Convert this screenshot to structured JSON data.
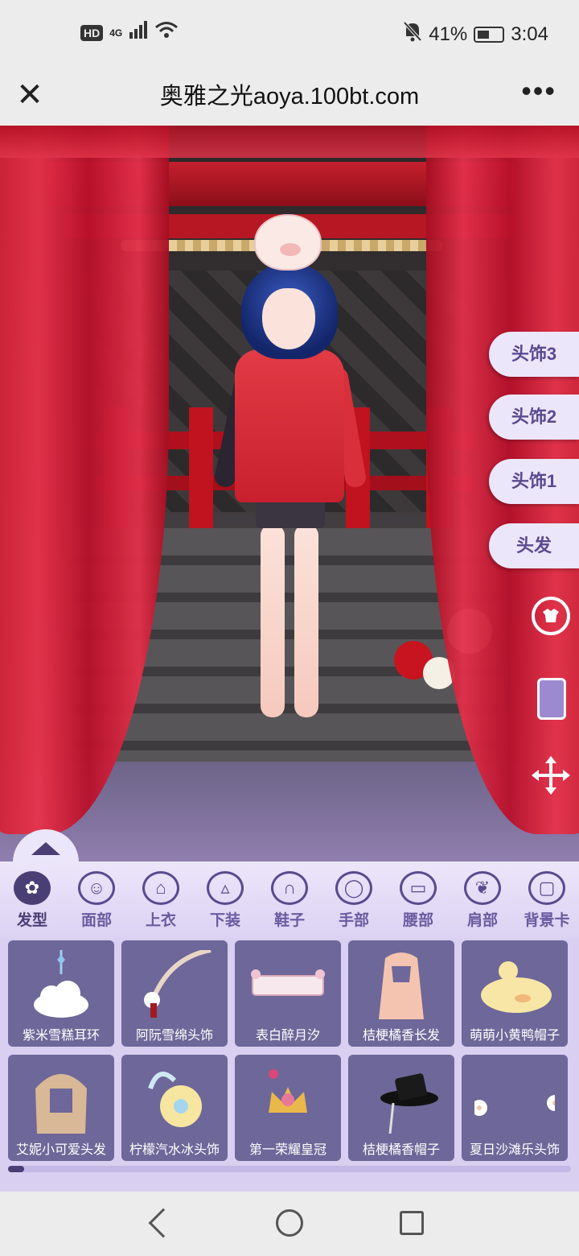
{
  "status_bar": {
    "network": "HD",
    "signal": "4G",
    "battery": "41%",
    "time": "3:04"
  },
  "browser": {
    "title": "奥雅之光aoya.100bt.com"
  },
  "side_slots": [
    "头饰3",
    "头饰2",
    "头饰1",
    "头发"
  ],
  "categories": [
    {
      "label": "发型",
      "icon": "hair-icon",
      "active": true
    },
    {
      "label": "面部",
      "icon": "face-icon"
    },
    {
      "label": "上衣",
      "icon": "top-icon"
    },
    {
      "label": "下装",
      "icon": "skirt-icon"
    },
    {
      "label": "鞋子",
      "icon": "shoes-icon"
    },
    {
      "label": "手部",
      "icon": "ring-icon"
    },
    {
      "label": "腰部",
      "icon": "belt-icon"
    },
    {
      "label": "肩部",
      "icon": "wings-icon"
    },
    {
      "label": "背景卡",
      "icon": "background-card-icon"
    }
  ],
  "items": [
    {
      "label": "紫米雪糕耳环"
    },
    {
      "label": "阿阮雪绵头饰"
    },
    {
      "label": "表白醉月汐"
    },
    {
      "label": "桔梗橘香长发"
    },
    {
      "label": "萌萌小黄鸭帽子"
    },
    {
      "label": "艾妮小可爱头发"
    },
    {
      "label": "柠檬汽水冰头饰"
    },
    {
      "label": "第一荣耀皇冠"
    },
    {
      "label": "桔梗橘香帽子"
    },
    {
      "label": "夏日沙滩乐头饰"
    }
  ],
  "colors": {
    "accent": "#4a3f75",
    "panel": "#ece6fa",
    "tile": "#6e6799",
    "curtain": "#e2304a"
  }
}
